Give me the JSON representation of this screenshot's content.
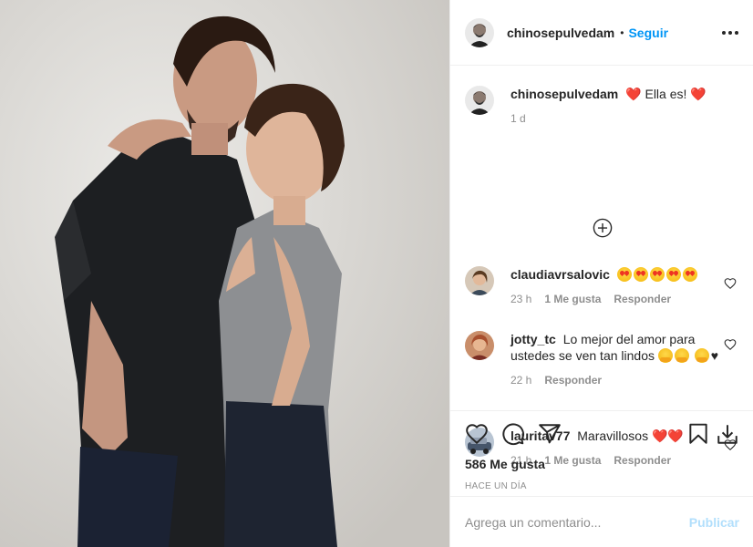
{
  "post": {
    "author": "chinosepulvedam",
    "dot": "•",
    "follow_label": "Seguir",
    "caption_text": "Ella es!",
    "caption_time": "1 d",
    "likes": "586 Me gusta",
    "posted": "HACE UN DÍA"
  },
  "comments": [
    {
      "user": "claudiavrsalovic",
      "time": "23 h",
      "likes": "1 Me gusta",
      "reply": "Responder",
      "emoji_count": 5
    },
    {
      "user": "jotty_tc",
      "text": "Lo mejor del amor para ustedes se ven tan lindos",
      "tail": "♥",
      "time": "22 h",
      "reply": "Responder"
    },
    {
      "user": "lauritav77",
      "text": "Maravillosos",
      "time": "21 h",
      "likes": "1 Me gusta",
      "reply": "Responder"
    }
  ],
  "composer": {
    "placeholder": "Agrega un comentario...",
    "publish_label": "Publicar"
  },
  "icons": [
    "more-icon",
    "heart-icon",
    "comment-icon",
    "share-icon",
    "save-icon",
    "download-icon",
    "plus-circle-icon",
    "like-comment-icon"
  ],
  "colors": {
    "accent": "#0095f6",
    "publish_disabled": "#b2dffc",
    "heart": "#ed1c24",
    "muted": "#8e8e8e"
  }
}
